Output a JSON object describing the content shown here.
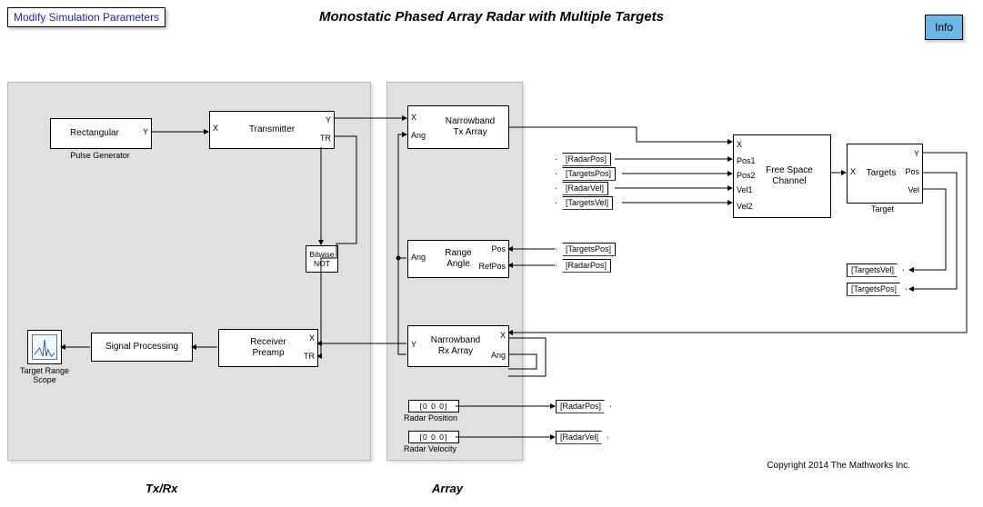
{
  "title": "Monostatic Phased Array Radar with Multiple Targets",
  "buttons": {
    "modify": "Modify Simulation Parameters",
    "info": "Info"
  },
  "groups": {
    "txrx": "Tx/Rx",
    "array": "Array"
  },
  "blocks": {
    "rectangular": "Rectangular",
    "pulse_gen_label": "Pulse Generator",
    "transmitter": "Transmitter",
    "bitwise_not": "Bitwise\nNOT",
    "signal_processing": "Signal Processing",
    "receiver_preamp": "Receiver\nPreamp",
    "scope_label": "Target Range\nScope",
    "nb_tx": "Narrowband\nTx Array",
    "range_angle": "Range\nAngle",
    "nb_rx": "Narrowband\nRx Array",
    "radar_pos_label": "Radar Position",
    "radar_vel_label": "Radar Velocity",
    "free_space": "Free Space\nChannel",
    "targets": "Targets",
    "target_label": "Target"
  },
  "ports": {
    "Y": "Y",
    "X": "X",
    "TR": "TR",
    "Ang": "Ang",
    "Pos": "Pos",
    "RefPos": "RefPos",
    "Pos1": "Pos1",
    "Pos2": "Pos2",
    "Vel1": "Vel1",
    "Vel2": "Vel2",
    "Vel": "Vel"
  },
  "tags": {
    "RadarPos": "[RadarPos]",
    "TargetsPos": "[TargetsPos]",
    "RadarVel": "[RadarVel]",
    "TargetsVel": "[TargetsVel]"
  },
  "consts": {
    "zeros": "[0 0 0]"
  },
  "copyright": "Copyright 2014 The Mathworks Inc."
}
